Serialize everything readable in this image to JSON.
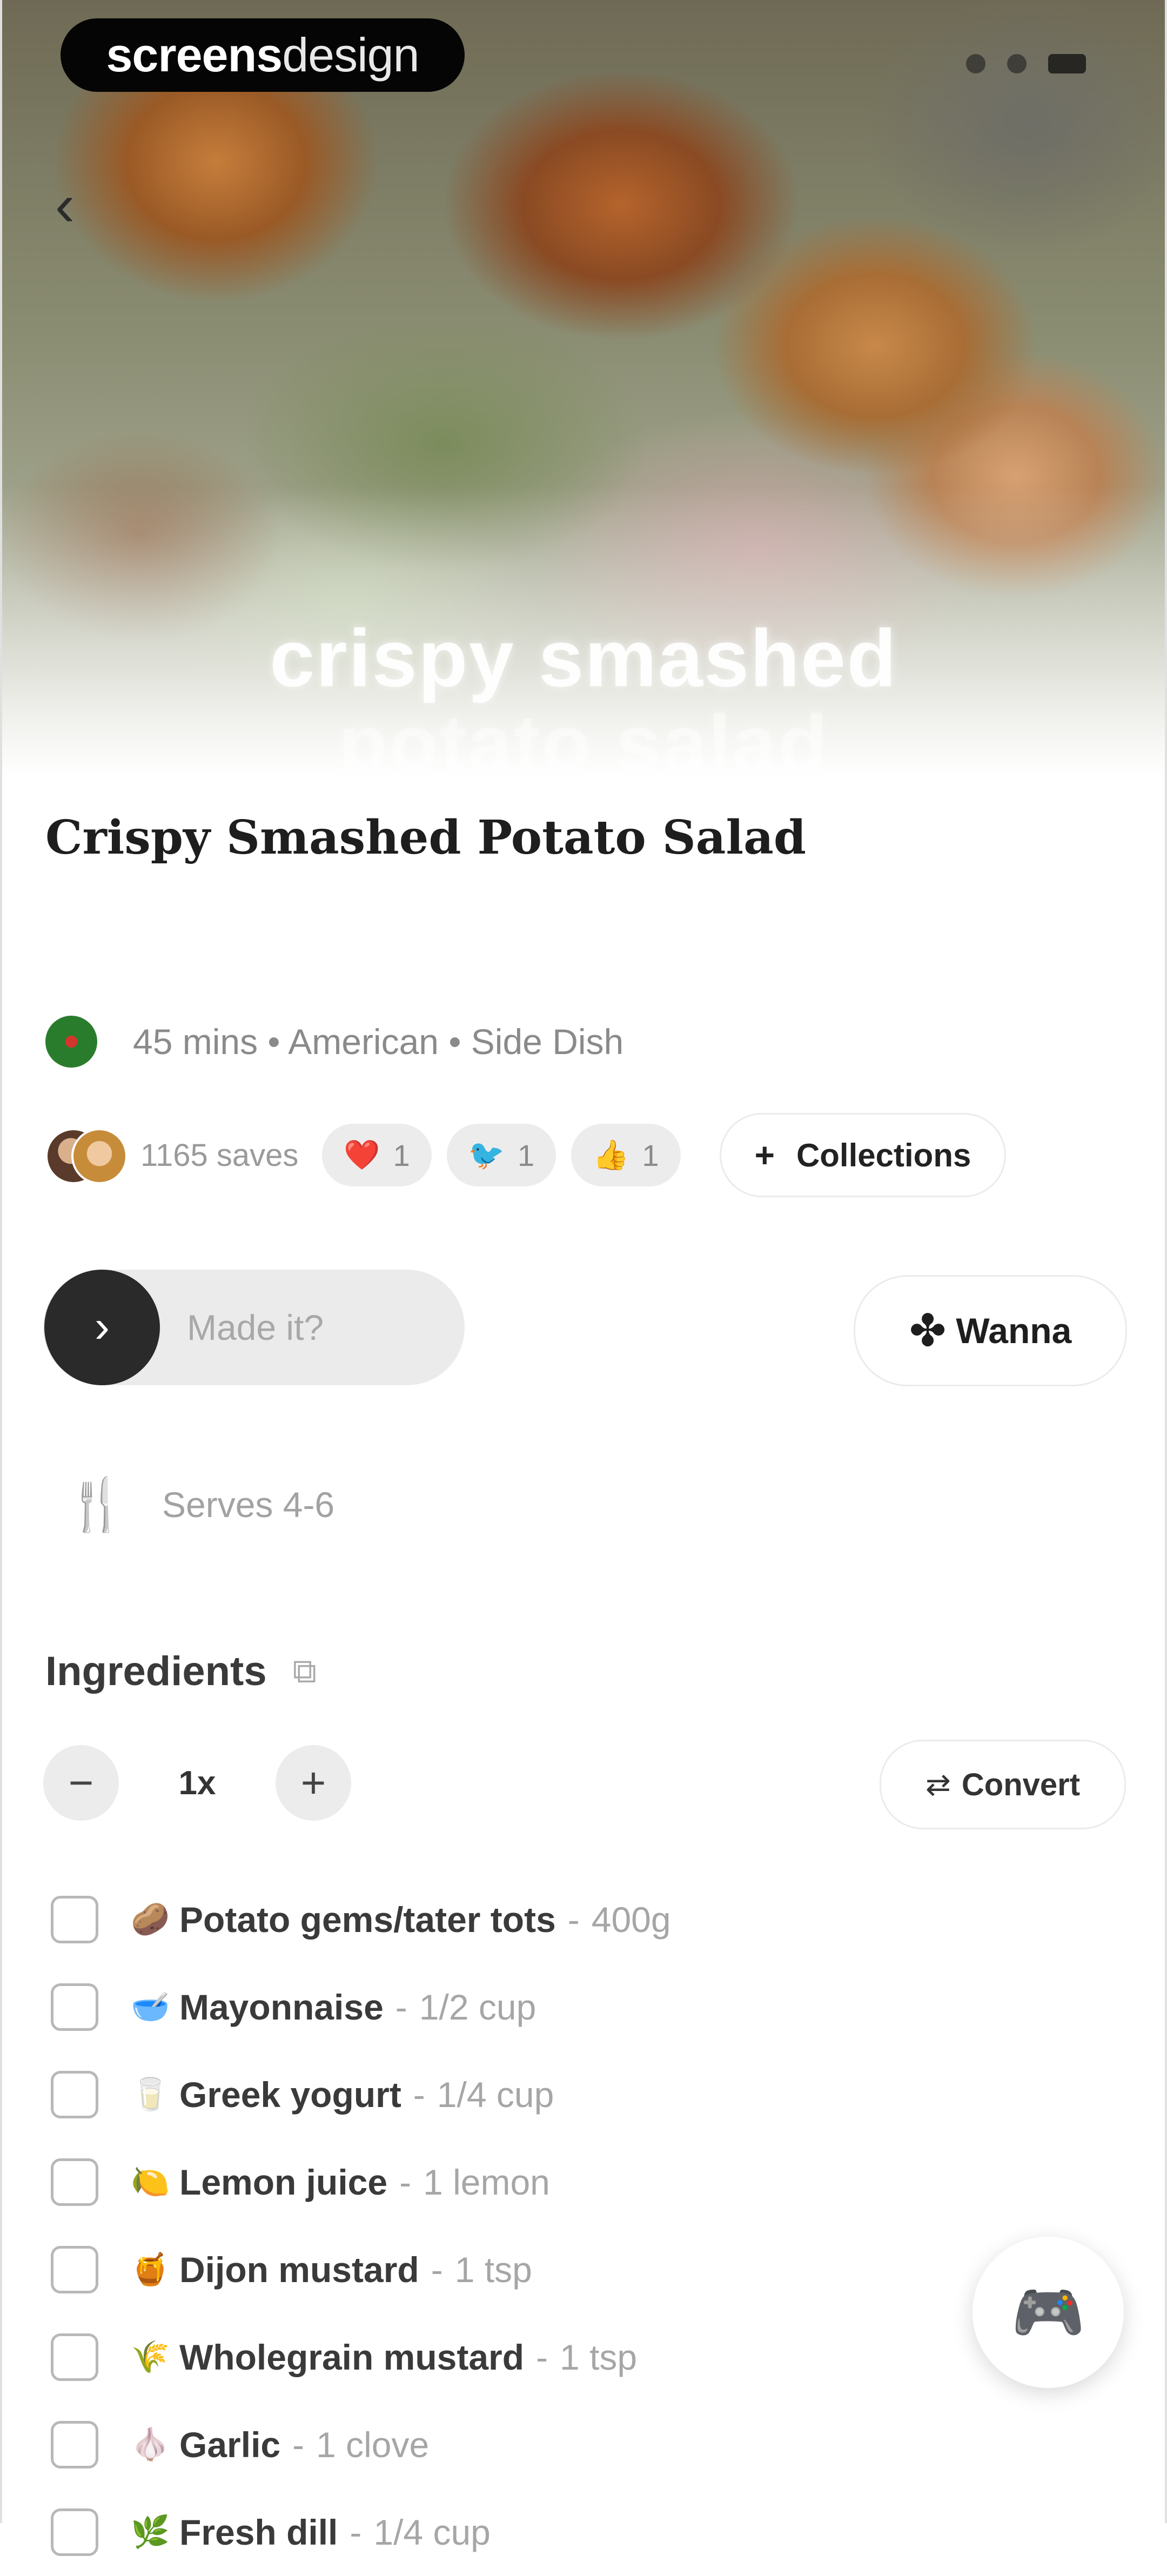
{
  "brand": {
    "bold": "screens",
    "light": "design"
  },
  "hero": {
    "overlay_line1": "crispy smashed",
    "overlay_line2": "potato salad",
    "back_icon": "chevron-left-icon"
  },
  "recipe": {
    "title": "Crispy Smashed Potato Salad",
    "meta": "45 mins • American • Side Dish",
    "saves": "1165 saves",
    "reactions": [
      {
        "emoji": "❤️",
        "count": "1"
      },
      {
        "emoji": "🐦",
        "count": "1"
      },
      {
        "emoji": "👍",
        "count": "1"
      }
    ],
    "collections_label": "Collections",
    "made_it_label": "Made it?",
    "wanna_label": "Wanna",
    "serves": "Serves 4-6"
  },
  "ingredients": {
    "header": "Ingredients",
    "scale": "1x",
    "convert_label": "Convert",
    "items": [
      {
        "emoji": "🥔",
        "name": "Potato gems/tater tots",
        "qty": "400g"
      },
      {
        "emoji": "🥣",
        "name": "Mayonnaise",
        "qty": "1/2 cup"
      },
      {
        "emoji": "🥛",
        "name": "Greek yogurt",
        "qty": "1/4 cup"
      },
      {
        "emoji": "🍋",
        "name": "Lemon juice",
        "qty": "1 lemon"
      },
      {
        "emoji": "🍯",
        "name": "Dijon mustard",
        "qty": "1 tsp"
      },
      {
        "emoji": "🌾",
        "name": "Wholegrain mustard",
        "qty": "1 tsp"
      },
      {
        "emoji": "🧄",
        "name": "Garlic",
        "qty": "1 clove"
      },
      {
        "emoji": "🌿",
        "name": "Fresh dill",
        "qty": "1/4 cup"
      }
    ]
  },
  "colors": {
    "accent": "#1e1e1e",
    "muted": "#a6a6a6",
    "pill_bg": "#ececec"
  }
}
